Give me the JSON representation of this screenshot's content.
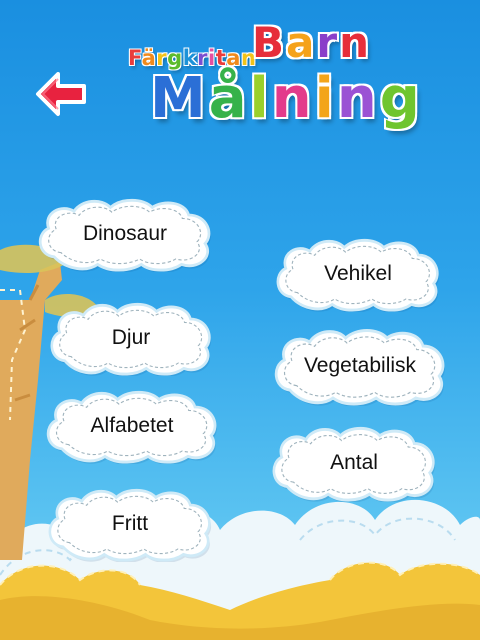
{
  "header": {
    "back_icon": "back-arrow-icon",
    "logo": {
      "small_text": "Färgkritan",
      "top_text": "Barn",
      "main_text": "Målning"
    }
  },
  "categories": [
    {
      "label": "Dinosaur"
    },
    {
      "label": "Djur"
    },
    {
      "label": "Alfabetet"
    },
    {
      "label": "Fritt"
    },
    {
      "label": "Vehikel"
    },
    {
      "label": "Vegetabilisk"
    },
    {
      "label": "Antal"
    }
  ],
  "colors": {
    "sky_top": "#1a8fe0",
    "sky_bottom": "#7fd3f6",
    "ground": "#f3c53a",
    "cloud_fill": "#ffffff",
    "cloud_outline": "#cfeaf7",
    "back_arrow": "#e8223f"
  }
}
